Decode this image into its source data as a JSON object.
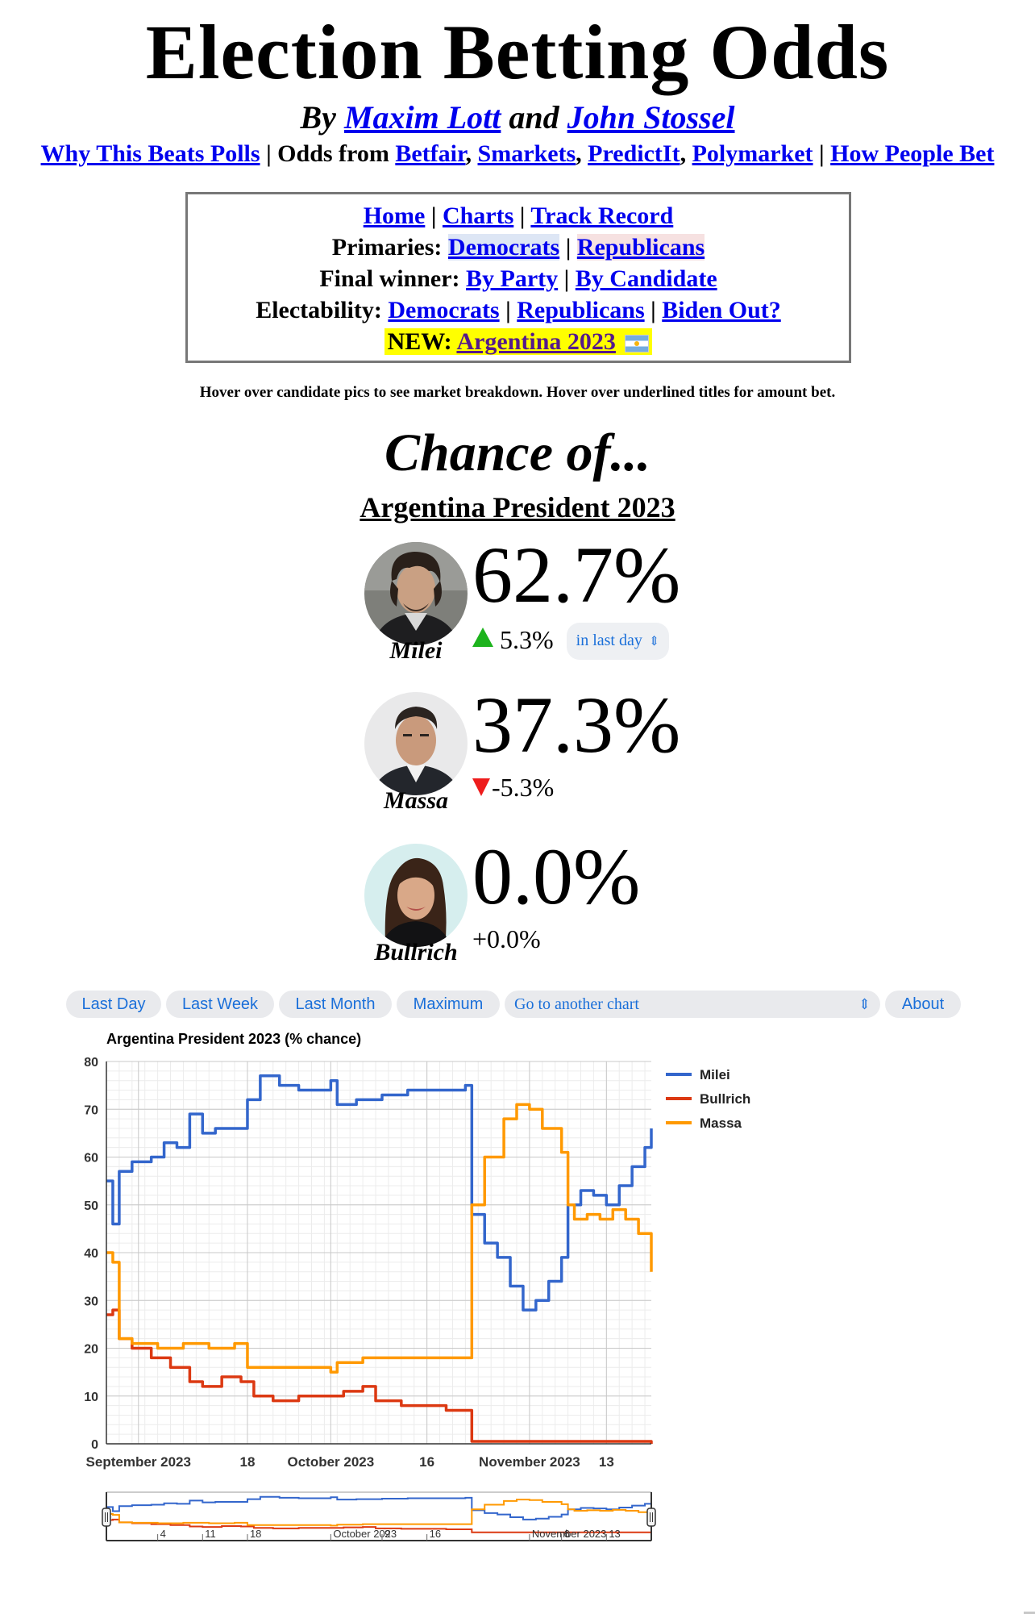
{
  "header": {
    "title": "Election Betting Odds",
    "by": "By",
    "author1": "Maxim Lott",
    "and": "and",
    "author2": "John Stossel"
  },
  "topnav": {
    "why": "Why This Beats Polls",
    "odds_from": "Odds from",
    "sources": [
      "Betfair",
      "Smarkets",
      "PredictIt",
      "Polymarket"
    ],
    "how": "How People Bet"
  },
  "menu": {
    "home": "Home",
    "charts": "Charts",
    "track_record": "Track Record",
    "primaries_label": "Primaries:",
    "primaries_dem": "Democrats",
    "primaries_rep": "Republicans",
    "final_label": "Final winner:",
    "by_party": "By Party",
    "by_candidate": "By Candidate",
    "electability_label": "Electability:",
    "elect_dem": "Democrats",
    "elect_rep": "Republicans",
    "biden_out": "Biden Out?",
    "new_label": "NEW:",
    "argentina": "Argentina 2023"
  },
  "hint": "Hover over candidate pics to see market breakdown. Hover over underlined titles for amount bet.",
  "chance_title": "Chance of...",
  "race_title": "Argentina President 2023",
  "candidates": [
    {
      "name": "Milei",
      "pct": "62.7%",
      "change": "5.3%",
      "direction": "up",
      "period": "in last day"
    },
    {
      "name": "Massa",
      "pct": "37.3%",
      "change": "-5.3%",
      "direction": "down"
    },
    {
      "name": "Bullrich",
      "pct": "0.0%",
      "change": "+0.0%",
      "direction": "none"
    }
  ],
  "chart_controls": {
    "last_day": "Last Day",
    "last_week": "Last Week",
    "last_month": "Last Month",
    "maximum": "Maximum",
    "goto": "Go to another chart",
    "about": "About"
  },
  "chart_data": {
    "type": "line",
    "title": "Argentina President 2023 (% chance)",
    "xlabel": "",
    "ylabel": "",
    "ylim": [
      0,
      80
    ],
    "yticks": [
      0,
      10,
      20,
      30,
      40,
      50,
      60,
      70,
      80
    ],
    "xlim": [
      "2023-08-27",
      "2023-11-20"
    ],
    "x_ticks": [
      {
        "date": "2023-09-01",
        "label": "September 2023"
      },
      {
        "date": "2023-09-18",
        "label": "18"
      },
      {
        "date": "2023-10-01",
        "label": "October 2023"
      },
      {
        "date": "2023-10-16",
        "label": "16"
      },
      {
        "date": "2023-11-01",
        "label": "November 2023"
      },
      {
        "date": "2023-11-13",
        "label": "13"
      }
    ],
    "nav_ticks": [
      {
        "date": "2023-09-04",
        "label": "4"
      },
      {
        "date": "2023-09-11",
        "label": "11"
      },
      {
        "date": "2023-09-18",
        "label": "18"
      },
      {
        "date": "2023-10-01",
        "label": "October 2023"
      },
      {
        "date": "2023-10-09",
        "label": "9"
      },
      {
        "date": "2023-10-16",
        "label": "16"
      },
      {
        "date": "2023-11-01",
        "label": "November 2023"
      },
      {
        "date": "2023-11-06",
        "label": "6"
      },
      {
        "date": "2023-11-13",
        "label": "13"
      }
    ],
    "legend_position": "right",
    "grid": true,
    "series": [
      {
        "name": "Milei",
        "color": "#3366cc",
        "points": [
          [
            "2023-08-27",
            55
          ],
          [
            "2023-08-28",
            46
          ],
          [
            "2023-08-29",
            57
          ],
          [
            "2023-08-31",
            59
          ],
          [
            "2023-09-03",
            60
          ],
          [
            "2023-09-05",
            63
          ],
          [
            "2023-09-07",
            62
          ],
          [
            "2023-09-09",
            69
          ],
          [
            "2023-09-11",
            65
          ],
          [
            "2023-09-13",
            66
          ],
          [
            "2023-09-15",
            66
          ],
          [
            "2023-09-17",
            66
          ],
          [
            "2023-09-18",
            72
          ],
          [
            "2023-09-20",
            77
          ],
          [
            "2023-09-23",
            75
          ],
          [
            "2023-09-26",
            74
          ],
          [
            "2023-09-29",
            74
          ],
          [
            "2023-10-01",
            76
          ],
          [
            "2023-10-02",
            71
          ],
          [
            "2023-10-05",
            72
          ],
          [
            "2023-10-09",
            73
          ],
          [
            "2023-10-13",
            74
          ],
          [
            "2023-10-17",
            74
          ],
          [
            "2023-10-20",
            74
          ],
          [
            "2023-10-22",
            75
          ],
          [
            "2023-10-23",
            48
          ],
          [
            "2023-10-25",
            42
          ],
          [
            "2023-10-27",
            39
          ],
          [
            "2023-10-29",
            33
          ],
          [
            "2023-10-31",
            28
          ],
          [
            "2023-11-02",
            30
          ],
          [
            "2023-11-04",
            34
          ],
          [
            "2023-11-06",
            39
          ],
          [
            "2023-11-07",
            50
          ],
          [
            "2023-11-09",
            53
          ],
          [
            "2023-11-11",
            52
          ],
          [
            "2023-11-13",
            50
          ],
          [
            "2023-11-15",
            54
          ],
          [
            "2023-11-17",
            58
          ],
          [
            "2023-11-19",
            62
          ],
          [
            "2023-11-20",
            66
          ]
        ]
      },
      {
        "name": "Bullrich",
        "color": "#dc3912",
        "points": [
          [
            "2023-08-27",
            27
          ],
          [
            "2023-08-28",
            28
          ],
          [
            "2023-08-29",
            22
          ],
          [
            "2023-08-31",
            20
          ],
          [
            "2023-09-03",
            18
          ],
          [
            "2023-09-06",
            16
          ],
          [
            "2023-09-09",
            13
          ],
          [
            "2023-09-11",
            12
          ],
          [
            "2023-09-14",
            14
          ],
          [
            "2023-09-17",
            13
          ],
          [
            "2023-09-19",
            10
          ],
          [
            "2023-09-22",
            9
          ],
          [
            "2023-09-26",
            10
          ],
          [
            "2023-09-30",
            10
          ],
          [
            "2023-10-03",
            11
          ],
          [
            "2023-10-06",
            12
          ],
          [
            "2023-10-08",
            9
          ],
          [
            "2023-10-12",
            8
          ],
          [
            "2023-10-16",
            8
          ],
          [
            "2023-10-19",
            7
          ],
          [
            "2023-10-22",
            7
          ],
          [
            "2023-10-23",
            0.5
          ],
          [
            "2023-11-20",
            0
          ]
        ]
      },
      {
        "name": "Massa",
        "color": "#ff9900",
        "points": [
          [
            "2023-08-27",
            40
          ],
          [
            "2023-08-28",
            38
          ],
          [
            "2023-08-29",
            22
          ],
          [
            "2023-08-31",
            21
          ],
          [
            "2023-09-04",
            20
          ],
          [
            "2023-09-08",
            21
          ],
          [
            "2023-09-12",
            20
          ],
          [
            "2023-09-16",
            21
          ],
          [
            "2023-09-18",
            16
          ],
          [
            "2023-09-21",
            16
          ],
          [
            "2023-09-24",
            16
          ],
          [
            "2023-09-28",
            16
          ],
          [
            "2023-10-01",
            15
          ],
          [
            "2023-10-02",
            17
          ],
          [
            "2023-10-06",
            18
          ],
          [
            "2023-10-10",
            18
          ],
          [
            "2023-10-14",
            18
          ],
          [
            "2023-10-18",
            18
          ],
          [
            "2023-10-22",
            18
          ],
          [
            "2023-10-23",
            50
          ],
          [
            "2023-10-25",
            60
          ],
          [
            "2023-10-28",
            68
          ],
          [
            "2023-10-30",
            71
          ],
          [
            "2023-11-01",
            70
          ],
          [
            "2023-11-03",
            66
          ],
          [
            "2023-11-06",
            61
          ],
          [
            "2023-11-07",
            50
          ],
          [
            "2023-11-08",
            47
          ],
          [
            "2023-11-10",
            48
          ],
          [
            "2023-11-12",
            47
          ],
          [
            "2023-11-14",
            49
          ],
          [
            "2023-11-16",
            47
          ],
          [
            "2023-11-18",
            44
          ],
          [
            "2023-11-20",
            36
          ]
        ]
      }
    ]
  }
}
